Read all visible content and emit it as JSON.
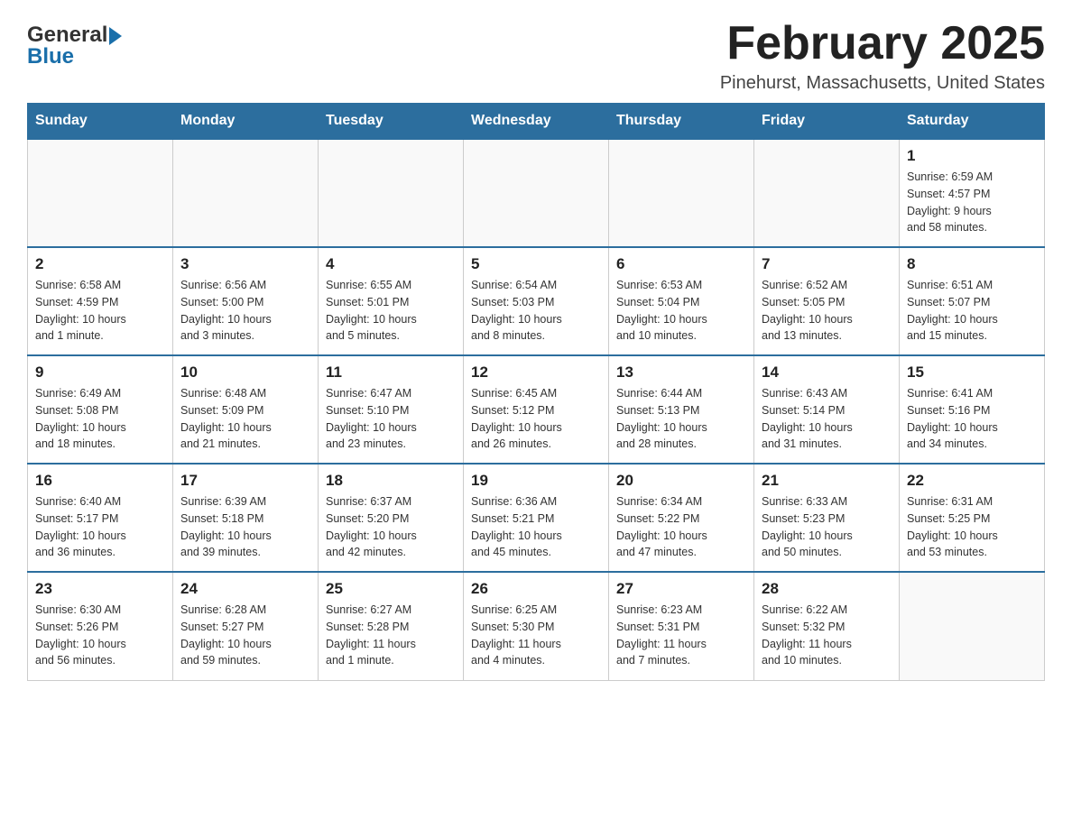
{
  "header": {
    "logo_general": "General",
    "logo_blue": "Blue",
    "title": "February 2025",
    "subtitle": "Pinehurst, Massachusetts, United States"
  },
  "days_of_week": [
    "Sunday",
    "Monday",
    "Tuesday",
    "Wednesday",
    "Thursday",
    "Friday",
    "Saturday"
  ],
  "weeks": [
    [
      {
        "day": "",
        "info": ""
      },
      {
        "day": "",
        "info": ""
      },
      {
        "day": "",
        "info": ""
      },
      {
        "day": "",
        "info": ""
      },
      {
        "day": "",
        "info": ""
      },
      {
        "day": "",
        "info": ""
      },
      {
        "day": "1",
        "info": "Sunrise: 6:59 AM\nSunset: 4:57 PM\nDaylight: 9 hours\nand 58 minutes."
      }
    ],
    [
      {
        "day": "2",
        "info": "Sunrise: 6:58 AM\nSunset: 4:59 PM\nDaylight: 10 hours\nand 1 minute."
      },
      {
        "day": "3",
        "info": "Sunrise: 6:56 AM\nSunset: 5:00 PM\nDaylight: 10 hours\nand 3 minutes."
      },
      {
        "day": "4",
        "info": "Sunrise: 6:55 AM\nSunset: 5:01 PM\nDaylight: 10 hours\nand 5 minutes."
      },
      {
        "day": "5",
        "info": "Sunrise: 6:54 AM\nSunset: 5:03 PM\nDaylight: 10 hours\nand 8 minutes."
      },
      {
        "day": "6",
        "info": "Sunrise: 6:53 AM\nSunset: 5:04 PM\nDaylight: 10 hours\nand 10 minutes."
      },
      {
        "day": "7",
        "info": "Sunrise: 6:52 AM\nSunset: 5:05 PM\nDaylight: 10 hours\nand 13 minutes."
      },
      {
        "day": "8",
        "info": "Sunrise: 6:51 AM\nSunset: 5:07 PM\nDaylight: 10 hours\nand 15 minutes."
      }
    ],
    [
      {
        "day": "9",
        "info": "Sunrise: 6:49 AM\nSunset: 5:08 PM\nDaylight: 10 hours\nand 18 minutes."
      },
      {
        "day": "10",
        "info": "Sunrise: 6:48 AM\nSunset: 5:09 PM\nDaylight: 10 hours\nand 21 minutes."
      },
      {
        "day": "11",
        "info": "Sunrise: 6:47 AM\nSunset: 5:10 PM\nDaylight: 10 hours\nand 23 minutes."
      },
      {
        "day": "12",
        "info": "Sunrise: 6:45 AM\nSunset: 5:12 PM\nDaylight: 10 hours\nand 26 minutes."
      },
      {
        "day": "13",
        "info": "Sunrise: 6:44 AM\nSunset: 5:13 PM\nDaylight: 10 hours\nand 28 minutes."
      },
      {
        "day": "14",
        "info": "Sunrise: 6:43 AM\nSunset: 5:14 PM\nDaylight: 10 hours\nand 31 minutes."
      },
      {
        "day": "15",
        "info": "Sunrise: 6:41 AM\nSunset: 5:16 PM\nDaylight: 10 hours\nand 34 minutes."
      }
    ],
    [
      {
        "day": "16",
        "info": "Sunrise: 6:40 AM\nSunset: 5:17 PM\nDaylight: 10 hours\nand 36 minutes."
      },
      {
        "day": "17",
        "info": "Sunrise: 6:39 AM\nSunset: 5:18 PM\nDaylight: 10 hours\nand 39 minutes."
      },
      {
        "day": "18",
        "info": "Sunrise: 6:37 AM\nSunset: 5:20 PM\nDaylight: 10 hours\nand 42 minutes."
      },
      {
        "day": "19",
        "info": "Sunrise: 6:36 AM\nSunset: 5:21 PM\nDaylight: 10 hours\nand 45 minutes."
      },
      {
        "day": "20",
        "info": "Sunrise: 6:34 AM\nSunset: 5:22 PM\nDaylight: 10 hours\nand 47 minutes."
      },
      {
        "day": "21",
        "info": "Sunrise: 6:33 AM\nSunset: 5:23 PM\nDaylight: 10 hours\nand 50 minutes."
      },
      {
        "day": "22",
        "info": "Sunrise: 6:31 AM\nSunset: 5:25 PM\nDaylight: 10 hours\nand 53 minutes."
      }
    ],
    [
      {
        "day": "23",
        "info": "Sunrise: 6:30 AM\nSunset: 5:26 PM\nDaylight: 10 hours\nand 56 minutes."
      },
      {
        "day": "24",
        "info": "Sunrise: 6:28 AM\nSunset: 5:27 PM\nDaylight: 10 hours\nand 59 minutes."
      },
      {
        "day": "25",
        "info": "Sunrise: 6:27 AM\nSunset: 5:28 PM\nDaylight: 11 hours\nand 1 minute."
      },
      {
        "day": "26",
        "info": "Sunrise: 6:25 AM\nSunset: 5:30 PM\nDaylight: 11 hours\nand 4 minutes."
      },
      {
        "day": "27",
        "info": "Sunrise: 6:23 AM\nSunset: 5:31 PM\nDaylight: 11 hours\nand 7 minutes."
      },
      {
        "day": "28",
        "info": "Sunrise: 6:22 AM\nSunset: 5:32 PM\nDaylight: 11 hours\nand 10 minutes."
      },
      {
        "day": "",
        "info": ""
      }
    ]
  ]
}
